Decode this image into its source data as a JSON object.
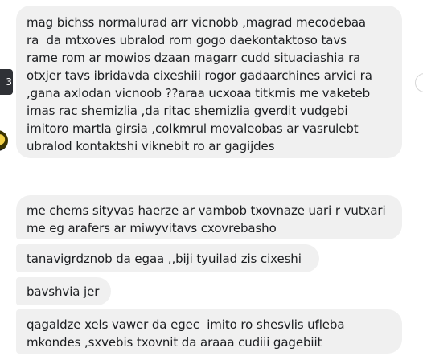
{
  "tooltip": {
    "text": "3"
  },
  "messages": [
    {
      "text": "mag bichss normalurad arr vicnobb ,magrad mecodebaa\nra  da mtxoves ubralod rom gogo daekontaktoso tavs\nrame rom ar mowios dzaan magarr cudd situaciashia ra\notxjer tavs ibridavda cixeshiii rogor gadaarchines arvici ra\n,gana axlodan vicnoob ??araa ucxoaa titkmis me vaketeb\nimas rac shemizlia ,da ritac shemizlia gverdit vudgebi\nimitoro martla girsia ,colkmrul movaleobas ar vasrulebt\nubralod kontaktshi viknebit ro ar gagijdes"
    },
    {
      "text": "me chems sityvas haerze ar vambob txovnaze uari r vutxari\nme eg arafers ar miwyvitavs cxovrebasho"
    },
    {
      "text": "tanavigrdznob da egaa ,,biji tyuilad zis cixeshi"
    },
    {
      "text": "bavshvia jer"
    },
    {
      "text": "qagaldze xels vawer da egec  imito ro shesvlis ufleba\nmkondes ,sxvebis txovnit da araaa cudiii gagebiit"
    }
  ]
}
